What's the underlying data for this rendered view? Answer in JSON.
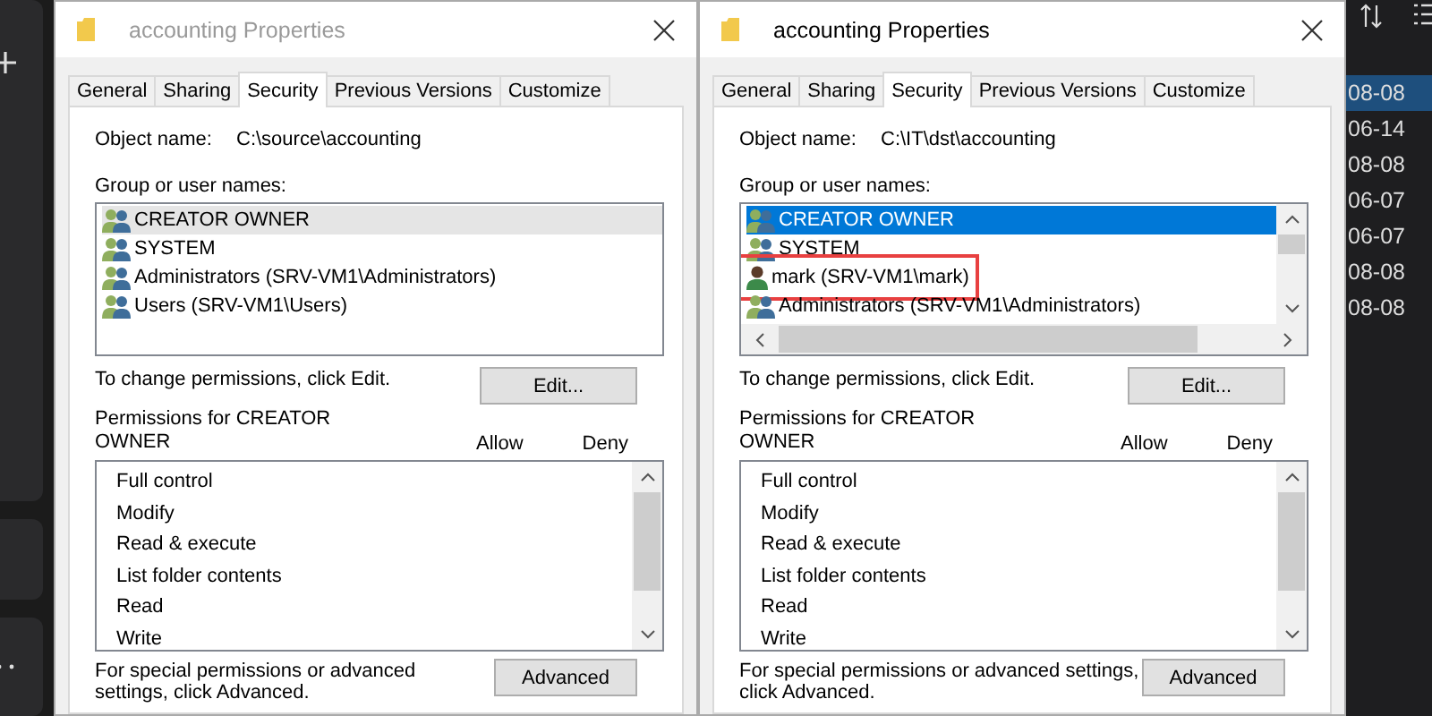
{
  "windows": [
    {
      "title": "accounting Properties",
      "active": false,
      "tabs": [
        {
          "label": "General",
          "selected": false
        },
        {
          "label": "Sharing",
          "selected": false
        },
        {
          "label": "Security",
          "selected": true
        },
        {
          "label": "Previous Versions",
          "selected": false
        },
        {
          "label": "Customize",
          "selected": false
        }
      ],
      "object_name_label": "Object name:",
      "object_name": "C:\\source\\accounting",
      "group_label": "Group or user names:",
      "list_scrollbars": false,
      "users": [
        {
          "name": "CREATOR OWNER",
          "kind": "group",
          "selected": true,
          "outlined": false
        },
        {
          "name": "SYSTEM",
          "kind": "group",
          "selected": false,
          "outlined": false
        },
        {
          "name": "Administrators (SRV-VM1\\Administrators)",
          "kind": "group",
          "selected": false,
          "outlined": false
        },
        {
          "name": "Users (SRV-VM1\\Users)",
          "kind": "group",
          "selected": false,
          "outlined": false
        }
      ],
      "edit_hint": "To change permissions, click Edit.",
      "edit_button": "Edit...",
      "permissions_label": "Permissions for CREATOR OWNER",
      "allow_label": "Allow",
      "deny_label": "Deny",
      "permissions": [
        "Full control",
        "Modify",
        "Read & execute",
        "List folder contents",
        "Read",
        "Write"
      ],
      "advanced_hint": "For special permissions or advanced settings, click Advanced.",
      "advanced_button": "Advanced"
    },
    {
      "title": "accounting Properties",
      "active": true,
      "tabs": [
        {
          "label": "General",
          "selected": false
        },
        {
          "label": "Sharing",
          "selected": false
        },
        {
          "label": "Security",
          "selected": true
        },
        {
          "label": "Previous Versions",
          "selected": false
        },
        {
          "label": "Customize",
          "selected": false
        }
      ],
      "object_name_label": "Object name:",
      "object_name": "C:\\IT\\dst\\accounting",
      "group_label": "Group or user names:",
      "list_scrollbars": true,
      "users": [
        {
          "name": "CREATOR OWNER",
          "kind": "group",
          "selected": true,
          "outlined": false
        },
        {
          "name": "SYSTEM",
          "kind": "group",
          "selected": false,
          "outlined": false
        },
        {
          "name": "mark (SRV-VM1\\mark)",
          "kind": "user",
          "selected": false,
          "outlined": true
        },
        {
          "name": "Administrators (SRV-VM1\\Administrators)",
          "kind": "group",
          "selected": false,
          "outlined": false
        }
      ],
      "edit_hint": "To change permissions, click Edit.",
      "edit_button": "Edit...",
      "permissions_label": "Permissions for CREATOR OWNER",
      "allow_label": "Allow",
      "deny_label": "Deny",
      "permissions": [
        "Full control",
        "Modify",
        "Read & execute",
        "List folder contents",
        "Read",
        "Write"
      ],
      "advanced_hint": "For special permissions or advanced settings, click Advanced.",
      "advanced_button": "Advanced"
    }
  ],
  "dates": [
    {
      "text": "08-08",
      "selected": true
    },
    {
      "text": "06-14",
      "selected": false
    },
    {
      "text": "08-08",
      "selected": false
    },
    {
      "text": "06-07",
      "selected": false
    },
    {
      "text": "06-07",
      "selected": false
    },
    {
      "text": "08-08",
      "selected": false
    },
    {
      "text": "08-08",
      "selected": false
    }
  ]
}
